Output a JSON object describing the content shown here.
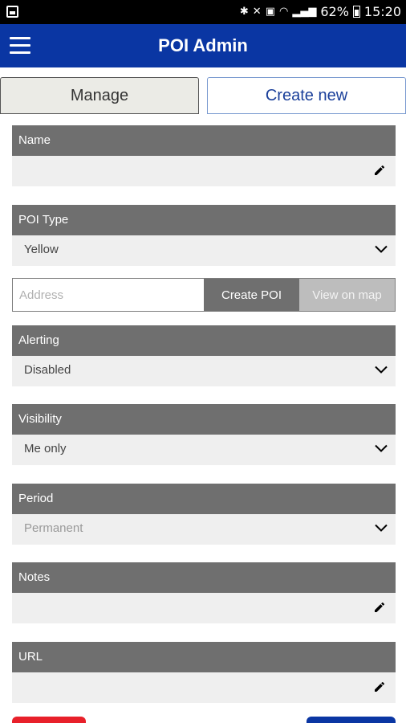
{
  "status_bar": {
    "battery": "62%",
    "time": "15:20",
    "icons": [
      "image-icon",
      "bluetooth-icon",
      "mute-icon",
      "vibrate-icon",
      "wifi-icon",
      "signal-icon",
      "battery-icon"
    ]
  },
  "app_bar": {
    "title": "POI Admin",
    "menu_icon": "hamburger-icon",
    "color": "#0a36a3"
  },
  "tabs": [
    {
      "label": "Manage",
      "active": false
    },
    {
      "label": "Create new",
      "active": true
    }
  ],
  "form": {
    "name": {
      "label": "Name",
      "value": ""
    },
    "poi_type": {
      "label": "POI Type",
      "value": "Yellow"
    },
    "address": {
      "placeholder": "Address",
      "value": ""
    },
    "create_button": "Create POI",
    "view_button": "View on map",
    "alerting": {
      "label": "Alerting",
      "value": "Disabled"
    },
    "visibility": {
      "label": "Visibility",
      "value": "Me only"
    },
    "period": {
      "label": "Period",
      "value": "Permanent"
    },
    "notes": {
      "label": "Notes",
      "value": ""
    },
    "url": {
      "label": "URL",
      "value": ""
    }
  },
  "colors": {
    "header_gray": "#6f6f6f",
    "body_gray": "#efefef",
    "danger_red": "#e8202a",
    "primary_blue": "#0a36a3"
  }
}
